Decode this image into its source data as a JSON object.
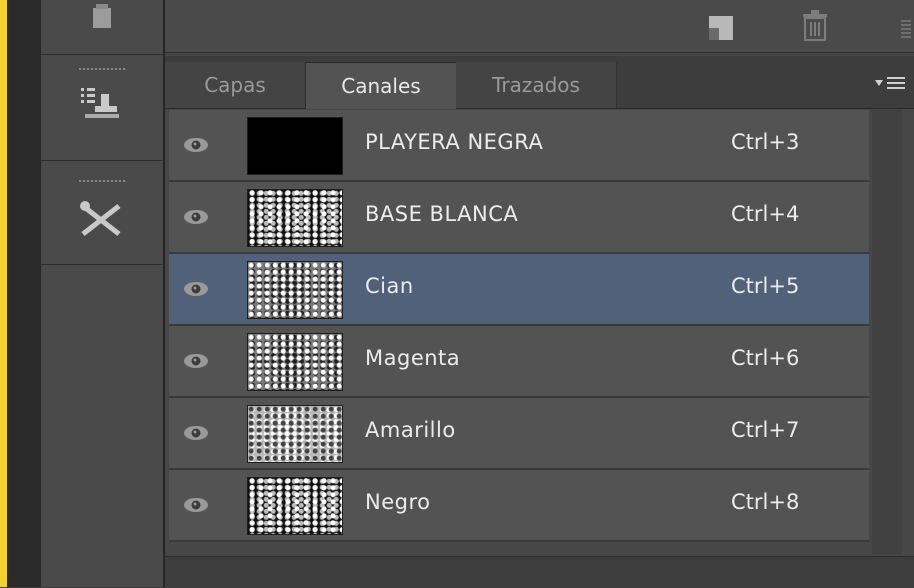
{
  "tabs": [
    {
      "label": "Capas",
      "active": false
    },
    {
      "label": "Canales",
      "active": true
    },
    {
      "label": "Trazados",
      "active": false
    }
  ],
  "channels": [
    {
      "name": "PLAYERA NEGRA",
      "shortcut": "Ctrl+3",
      "visible": true,
      "selected": false,
      "thumbnail": "solid-black"
    },
    {
      "name": "BASE BLANCA",
      "shortcut": "Ctrl+4",
      "visible": true,
      "selected": false,
      "thumbnail": "dark-speckled"
    },
    {
      "name": "Cian",
      "shortcut": "Ctrl+5",
      "visible": true,
      "selected": true,
      "thumbnail": "grey-speckled"
    },
    {
      "name": "Magenta",
      "shortcut": "Ctrl+6",
      "visible": true,
      "selected": false,
      "thumbnail": "grey-speckled"
    },
    {
      "name": "Amarillo",
      "shortcut": "Ctrl+7",
      "visible": true,
      "selected": false,
      "thumbnail": "light-speckled"
    },
    {
      "name": "Negro",
      "shortcut": "Ctrl+8",
      "visible": true,
      "selected": false,
      "thumbnail": "dark-speckled"
    }
  ],
  "icons": {
    "eye": "eye-icon",
    "tools": [
      "clone-stamp-icon",
      "brush-list-icon",
      "tools-icon"
    ],
    "toolbar": [
      "new-channel-icon",
      "trash-icon",
      "panel-menu-icon"
    ]
  },
  "colors": {
    "selected_row": "#52617a",
    "row": "#535353",
    "accent_border": "#f2d233"
  }
}
